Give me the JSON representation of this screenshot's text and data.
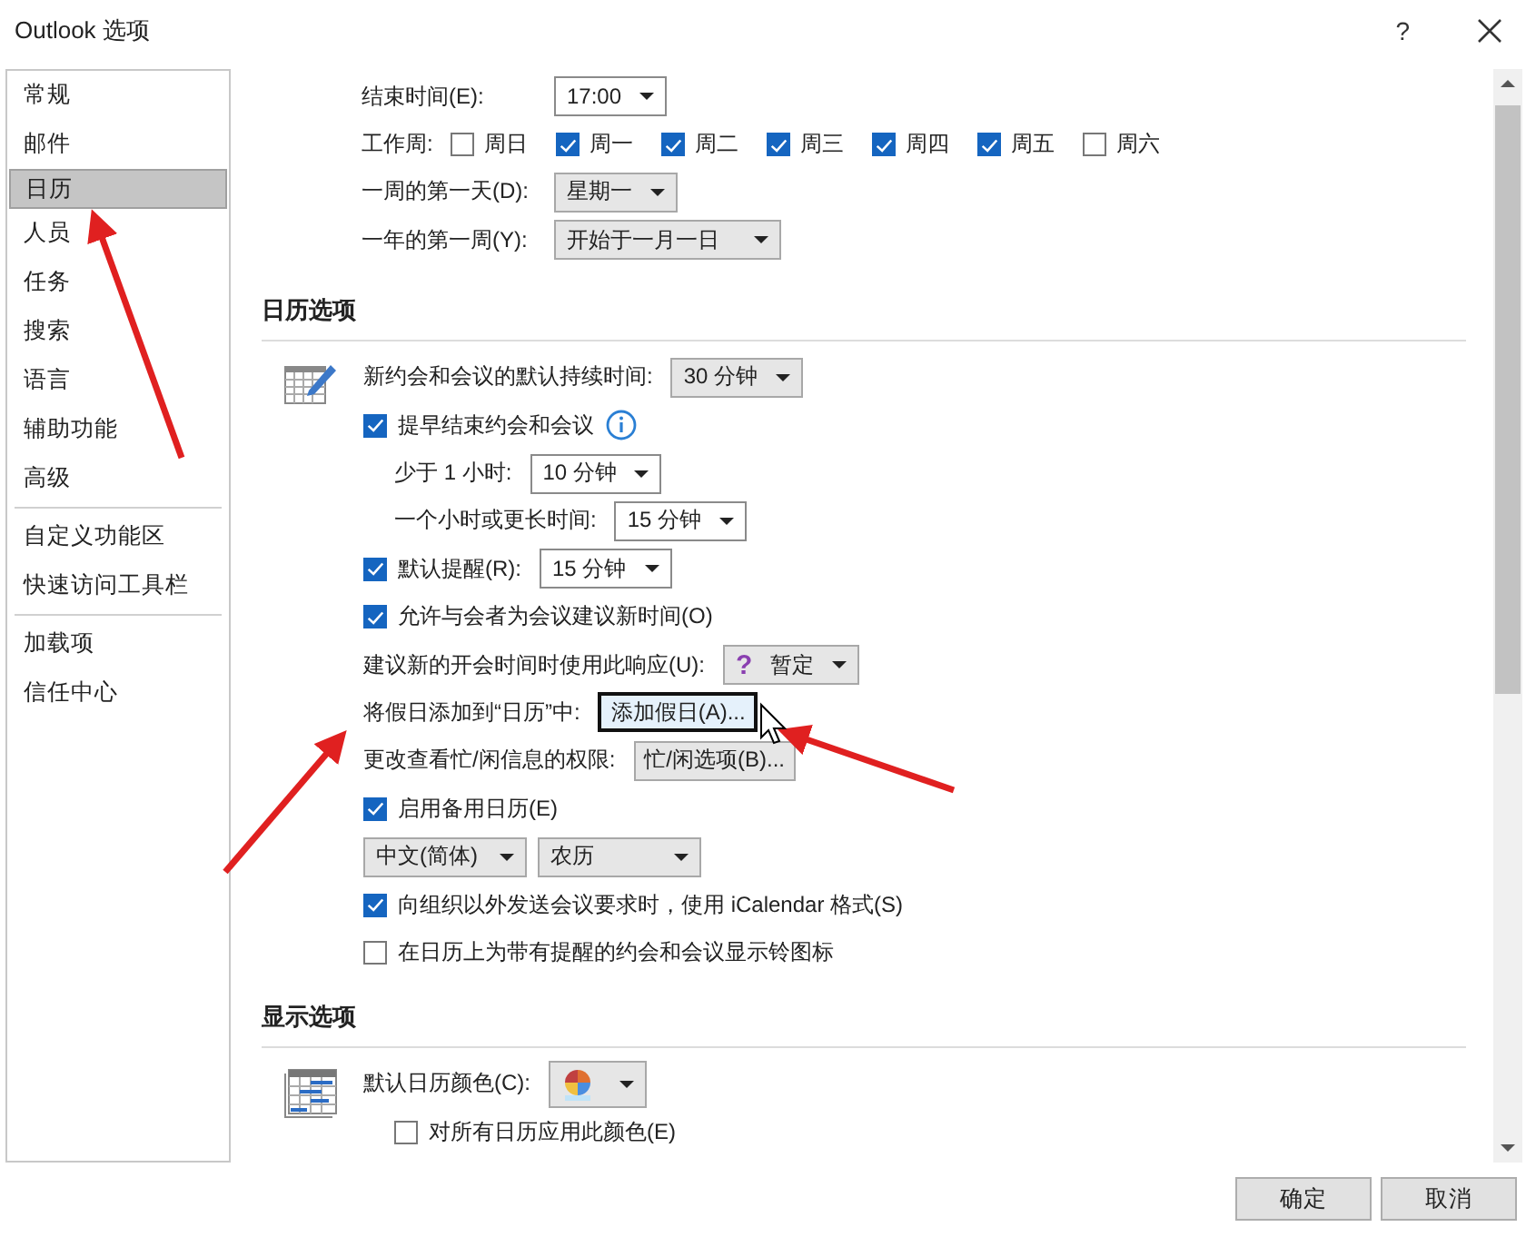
{
  "window": {
    "title": "Outlook 选项",
    "help": "?"
  },
  "sidebar": {
    "groups": [
      [
        {
          "label": "常规",
          "selected": false
        },
        {
          "label": "邮件",
          "selected": false
        },
        {
          "label": "日历",
          "selected": true
        },
        {
          "label": "人员",
          "selected": false
        },
        {
          "label": "任务",
          "selected": false
        },
        {
          "label": "搜索",
          "selected": false
        },
        {
          "label": "语言",
          "selected": false
        },
        {
          "label": "辅助功能",
          "selected": false
        },
        {
          "label": "高级",
          "selected": false
        }
      ],
      [
        {
          "label": "自定义功能区",
          "selected": false
        },
        {
          "label": "快速访问工具栏",
          "selected": false
        }
      ],
      [
        {
          "label": "加载项",
          "selected": false
        },
        {
          "label": "信任中心",
          "selected": false
        }
      ]
    ]
  },
  "work_time": {
    "end_time": {
      "label": "结束时间(E):",
      "value": "17:00"
    },
    "work_week": {
      "label": "工作周:",
      "days": [
        {
          "label": "周日",
          "checked": false
        },
        {
          "label": "周一",
          "checked": true
        },
        {
          "label": "周二",
          "checked": true
        },
        {
          "label": "周三",
          "checked": true
        },
        {
          "label": "周四",
          "checked": true
        },
        {
          "label": "周五",
          "checked": true
        },
        {
          "label": "周六",
          "checked": false
        }
      ]
    },
    "first_day": {
      "label": "一周的第一天(D):",
      "value": "星期一"
    },
    "first_week": {
      "label": "一年的第一周(Y):",
      "value": "开始于一月一日"
    }
  },
  "calendar_options": {
    "title": "日历选项",
    "rows": [
      {
        "kind": "dropdown",
        "label": "新约会和会议的默认持续时间:",
        "value": "30 分钟"
      },
      {
        "kind": "checkbox",
        "label": "提早结束约会和会议",
        "checked": true,
        "info": true,
        "children": [
          {
            "kind": "combo",
            "label": "少于 1 小时:",
            "value": "10 分钟"
          },
          {
            "kind": "combo",
            "label": "一个小时或更长时间:",
            "value": "15 分钟"
          }
        ]
      },
      {
        "kind": "checkbox_combo",
        "label": "默认提醒(R):",
        "checked": true,
        "value": "15 分钟"
      },
      {
        "kind": "checkbox",
        "label": "允许与会者为会议建议新时间(O)",
        "checked": true
      },
      {
        "kind": "dropdown",
        "label": "建议新的开会时间时使用此响应(U):",
        "glyph": "?",
        "value": "暂定"
      },
      {
        "kind": "button",
        "label": "将假日添加到“日历”中:",
        "button": "添加假日(A)...",
        "focused": true
      },
      {
        "kind": "button",
        "label": "更改查看忙/闲信息的权限:",
        "button": "忙/闲选项(B)...",
        "focused": false
      },
      {
        "kind": "checkbox",
        "label": "启用备用日历(E)",
        "checked": true
      },
      {
        "kind": "dropdown_pair",
        "values": [
          "中文(简体)",
          "农历"
        ]
      },
      {
        "kind": "checkbox",
        "label": "向组织以外发送会议要求时，使用 iCalendar 格式(S)",
        "checked": true
      },
      {
        "kind": "checkbox",
        "label": "在日历上为带有提醒的约会和会议显示铃图标",
        "checked": false
      }
    ]
  },
  "display_options": {
    "title": "显示选项",
    "color_label": "默认日历颜色(C):",
    "apply_all": {
      "label": "对所有日历应用此颜色(E)",
      "checked": false
    }
  },
  "buttons": [
    "确定",
    "取消"
  ]
}
